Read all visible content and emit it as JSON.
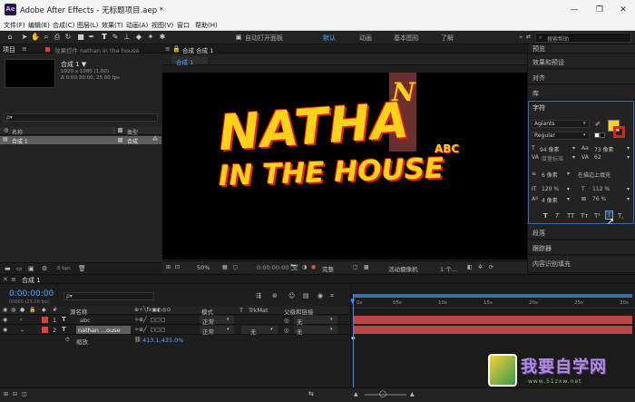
{
  "app": {
    "title": "Adobe After Effects - 无标题项目.aep *",
    "logo": "Ae"
  },
  "window_controls": {
    "minimize": "—",
    "maximize": "❐",
    "close": "✕"
  },
  "menu": [
    "文件(F)",
    "编辑(E)",
    "合成(C)",
    "图层(L)",
    "效果(T)",
    "动画(A)",
    "视图(V)",
    "窗口",
    "帮助(H)"
  ],
  "toolbar": {
    "auto_open": "自动打开面板",
    "workspaces": [
      "默认",
      "动画",
      "基本图形",
      "了解"
    ],
    "active_workspace": "默认",
    "search_placeholder": "搜索帮助",
    "tools": [
      "home-icon",
      "arrow-icon",
      "hand-icon",
      "zoom-icon",
      "camera-icon",
      "rotate-icon",
      "rect-icon",
      "pen-icon",
      "type-icon",
      "brush-icon",
      "stamp-icon",
      "eraser-icon",
      "roto-icon",
      "pin-icon"
    ]
  },
  "project_panel": {
    "tab_project": "项目",
    "tab_effects": "效果控件 nathan in the house",
    "comp_name": "合成 1 ▼",
    "comp_info_1": "1920 x 1080 (1.00)",
    "comp_info_2": "Δ 0:00:30:00, 25.00 fps",
    "search_placeholder": "ρ▾",
    "col_name": "名称",
    "col_type": "类型",
    "item_name": "合成 1",
    "item_type": "合成",
    "bpc": "8 bpc"
  },
  "comp_panel": {
    "tab": "合成 合成 1",
    "sub_tab": "合成 1",
    "zoom": "50%",
    "timecode": "0:00:00:00",
    "quality": "完整",
    "camera": "活动摄像机",
    "views": "1 个...",
    "artwork": {
      "line1": "NATHA",
      "letter_n": "N",
      "line2": "IN THE HOUSE",
      "abc": "ABC"
    }
  },
  "right_panel": {
    "items_top": [
      "预览",
      "效果和预设",
      "对齐",
      "库"
    ],
    "character": {
      "title": "字符",
      "font": "Agiants",
      "style": "Regular",
      "size": "94 像素",
      "leading": "73 像素",
      "kerning": "度量标准",
      "tracking": "62",
      "stroke_width": "6 像素",
      "stroke_mode": "在描边上填充",
      "vscale": "120 %",
      "hscale": "112 %",
      "baseline": "4 像素",
      "tsume": "76 %",
      "fill_color": "#ffd21a",
      "stroke_color": "#e31e1e",
      "styles": [
        "T",
        "T",
        "TT",
        "Tт",
        "T¹",
        "T",
        "T,"
      ]
    },
    "items_bottom": [
      "段落",
      "跟踪器",
      "内容识别填充"
    ]
  },
  "timeline": {
    "tab": "合成 1",
    "timecode": "0:00:00:00",
    "fps": "00000 (25.00 fps)",
    "search_placeholder": "ρ▾",
    "col_source": "源名称",
    "col_mode": "模式",
    "col_t": "T",
    "col_trkmat": "TrkMat",
    "col_parent": "父级和链接",
    "layers": [
      {
        "num": "1",
        "name": "abc",
        "mode": "正常",
        "trkmat": "",
        "parent": "无",
        "color": "#d94040"
      },
      {
        "num": "2",
        "name": "nathan ...ouse",
        "mode": "正常",
        "trkmat": "无",
        "parent": "无",
        "color": "#d94040"
      }
    ],
    "prop_name": "缩放",
    "prop_value": "413.1,435.0%",
    "ruler": [
      "0s",
      "05s",
      "10s",
      "15s",
      "20s",
      "25s",
      "30s"
    ]
  },
  "watermark": {
    "brand": "我要自学网",
    "url": "www.51zxw.net"
  }
}
